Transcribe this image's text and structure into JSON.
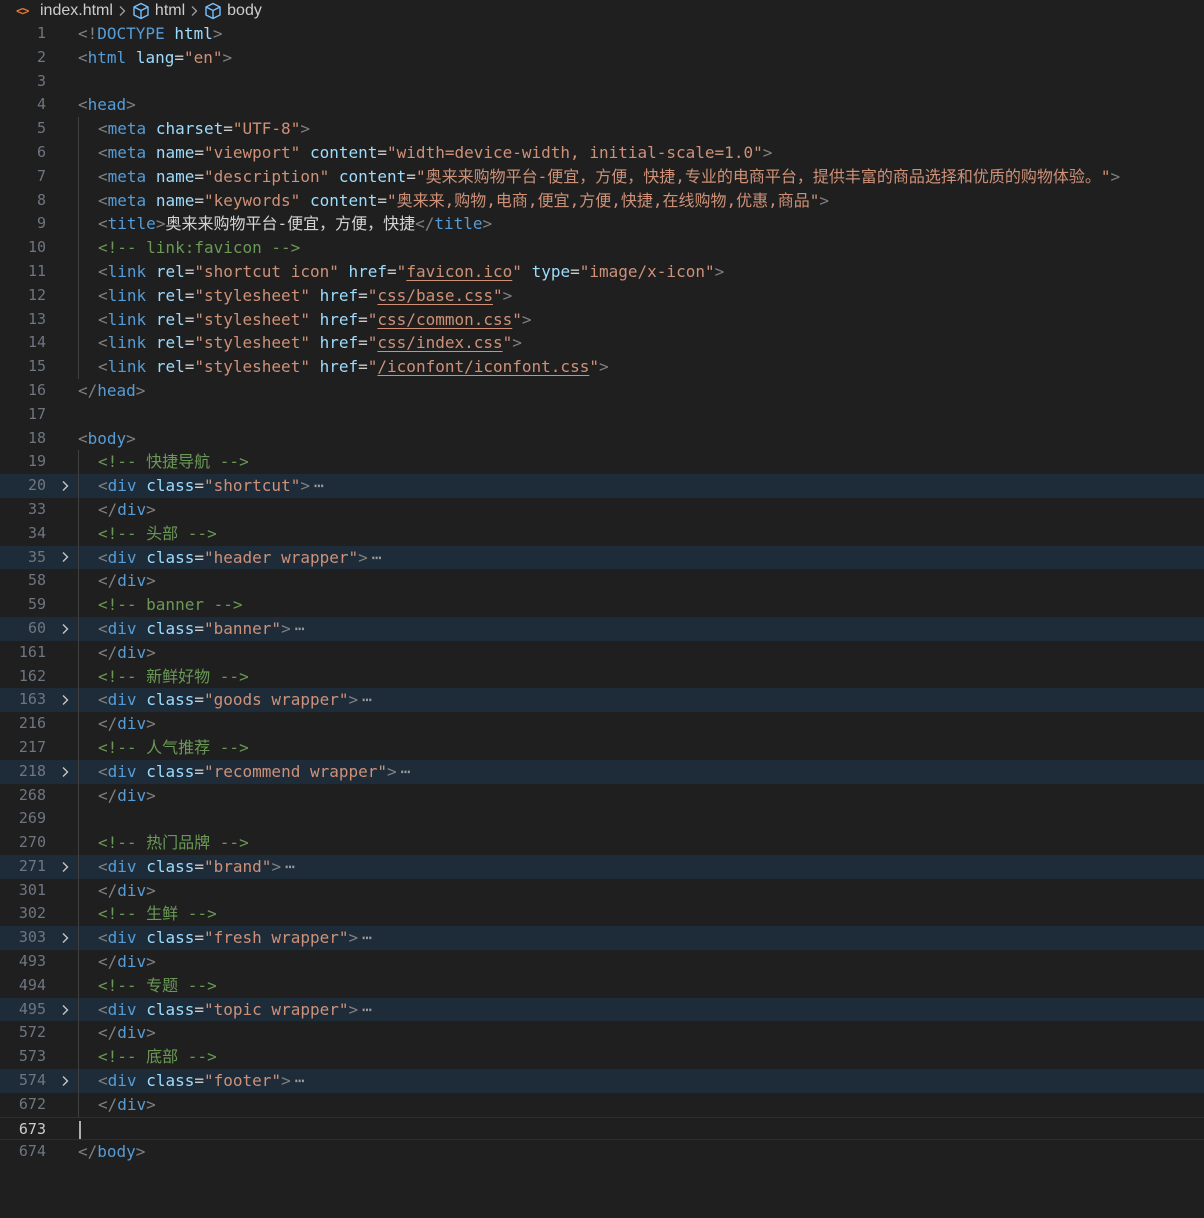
{
  "breadcrumb": {
    "file_icon_glyph": "<>",
    "file": "index.html",
    "items": [
      "html",
      "body"
    ]
  },
  "colors": {
    "background": "#1f1f1f",
    "tag": "#569cd6",
    "attribute": "#9cdcfe",
    "string": "#ce9178",
    "comment": "#6a9955",
    "punctuation": "#808080",
    "folded_highlight": "#1e2c39",
    "line_number": "#6e7681"
  },
  "lines": [
    {
      "n": "1",
      "indent": false,
      "folded": false,
      "html": "<span class='t-punc'>&lt;!</span><span class='t-tag'>DOCTYPE</span> <span class='t-doctype-name'>html</span><span class='t-punc'>&gt;</span>"
    },
    {
      "n": "2",
      "indent": false,
      "folded": false,
      "html": "<span class='t-punc'>&lt;</span><span class='t-tag'>html</span> <span class='t-attr'>lang</span><span class='t-eq'>=</span><span class='t-str'>\"en\"</span><span class='t-punc'>&gt;</span>"
    },
    {
      "n": "3",
      "indent": false,
      "folded": false,
      "html": ""
    },
    {
      "n": "4",
      "indent": false,
      "folded": false,
      "html": "<span class='t-punc'>&lt;</span><span class='t-tag'>head</span><span class='t-punc'>&gt;</span>"
    },
    {
      "n": "5",
      "indent": true,
      "folded": false,
      "html": "<span class='t-punc'>&lt;</span><span class='t-tag'>meta</span> <span class='t-attr'>charset</span><span class='t-eq'>=</span><span class='t-str'>\"UTF-8\"</span><span class='t-punc'>&gt;</span>"
    },
    {
      "n": "6",
      "indent": true,
      "folded": false,
      "html": "<span class='t-punc'>&lt;</span><span class='t-tag'>meta</span> <span class='t-attr'>name</span><span class='t-eq'>=</span><span class='t-str'>\"viewport\"</span> <span class='t-attr'>content</span><span class='t-eq'>=</span><span class='t-str'>\"width=device-width, initial-scale=1.0\"</span><span class='t-punc'>&gt;</span>"
    },
    {
      "n": "7",
      "indent": true,
      "folded": false,
      "html": "<span class='t-punc'>&lt;</span><span class='t-tag'>meta</span> <span class='t-attr'>name</span><span class='t-eq'>=</span><span class='t-str'>\"description\"</span> <span class='t-attr'>content</span><span class='t-eq'>=</span><span class='t-str'>\"奥来来购物平台-便宜，方便，快捷,专业的电商平台，提供丰富的商品选择和优质的购物体验。\"</span><span class='t-punc'>&gt;</span>"
    },
    {
      "n": "8",
      "indent": true,
      "folded": false,
      "html": "<span class='t-punc'>&lt;</span><span class='t-tag'>meta</span> <span class='t-attr'>name</span><span class='t-eq'>=</span><span class='t-str'>\"keywords\"</span> <span class='t-attr'>content</span><span class='t-eq'>=</span><span class='t-str'>\"奥来来,购物,电商,便宜,方便,快捷,在线购物,优惠,商品\"</span><span class='t-punc'>&gt;</span>"
    },
    {
      "n": "9",
      "indent": true,
      "folded": false,
      "html": "<span class='t-punc'>&lt;</span><span class='t-tag'>title</span><span class='t-punc'>&gt;</span><span class='t-text'>奥来来购物平台-便宜，方便，快捷</span><span class='t-punc'>&lt;/</span><span class='t-tag'>title</span><span class='t-punc'>&gt;</span>"
    },
    {
      "n": "10",
      "indent": true,
      "folded": false,
      "html": "<span class='t-comment'>&lt;!-- link:favicon --&gt;</span>"
    },
    {
      "n": "11",
      "indent": true,
      "folded": false,
      "html": "<span class='t-punc'>&lt;</span><span class='t-tag'>link</span> <span class='t-attr'>rel</span><span class='t-eq'>=</span><span class='t-str'>\"shortcut icon\"</span> <span class='t-attr'>href</span><span class='t-eq'>=</span><span class='t-str'>\"</span><span class='t-str-u'>favicon.ico</span><span class='t-str'>\"</span> <span class='t-attr'>type</span><span class='t-eq'>=</span><span class='t-str'>\"image/x-icon\"</span><span class='t-punc'>&gt;</span>"
    },
    {
      "n": "12",
      "indent": true,
      "folded": false,
      "html": "<span class='t-punc'>&lt;</span><span class='t-tag'>link</span> <span class='t-attr'>rel</span><span class='t-eq'>=</span><span class='t-str'>\"stylesheet\"</span> <span class='t-attr'>href</span><span class='t-eq'>=</span><span class='t-str'>\"</span><span class='t-str-u'>css/base.css</span><span class='t-str'>\"</span><span class='t-punc'>&gt;</span>"
    },
    {
      "n": "13",
      "indent": true,
      "folded": false,
      "html": "<span class='t-punc'>&lt;</span><span class='t-tag'>link</span> <span class='t-attr'>rel</span><span class='t-eq'>=</span><span class='t-str'>\"stylesheet\"</span> <span class='t-attr'>href</span><span class='t-eq'>=</span><span class='t-str'>\"</span><span class='t-str-u'>css/common.css</span><span class='t-str'>\"</span><span class='t-punc'>&gt;</span>"
    },
    {
      "n": "14",
      "indent": true,
      "folded": false,
      "html": "<span class='t-punc'>&lt;</span><span class='t-tag'>link</span> <span class='t-attr'>rel</span><span class='t-eq'>=</span><span class='t-str'>\"stylesheet\"</span> <span class='t-attr'>href</span><span class='t-eq'>=</span><span class='t-str'>\"</span><span class='t-str-u'>css/index.css</span><span class='t-str'>\"</span><span class='t-punc'>&gt;</span>"
    },
    {
      "n": "15",
      "indent": true,
      "folded": false,
      "html": "<span class='t-punc'>&lt;</span><span class='t-tag'>link</span> <span class='t-attr'>rel</span><span class='t-eq'>=</span><span class='t-str'>\"stylesheet\"</span> <span class='t-attr'>href</span><span class='t-eq'>=</span><span class='t-str'>\"</span><span class='t-str-u'>/iconfont/iconfont.css</span><span class='t-str'>\"</span><span class='t-punc'>&gt;</span>"
    },
    {
      "n": "16",
      "indent": false,
      "folded": false,
      "html": "<span class='t-punc'>&lt;/</span><span class='t-tag'>head</span><span class='t-punc'>&gt;</span>"
    },
    {
      "n": "17",
      "indent": false,
      "folded": false,
      "html": ""
    },
    {
      "n": "18",
      "indent": false,
      "folded": false,
      "html": "<span class='t-punc'>&lt;</span><span class='t-tag'>body</span><span class='t-punc'>&gt;</span>"
    },
    {
      "n": "19",
      "indent": true,
      "folded": false,
      "html": "<span class='t-comment'>&lt;!-- 快捷导航 --&gt;</span>"
    },
    {
      "n": "20",
      "indent": true,
      "folded": true,
      "html": "<span class='t-punc'>&lt;</span><span class='t-tag'>div</span> <span class='t-attr'>class</span><span class='t-eq'>=</span><span class='t-str'>\"shortcut\"</span><span class='t-punc'>&gt;</span><span class='t-ellipsis'>⋯</span>"
    },
    {
      "n": "33",
      "indent": true,
      "folded": false,
      "html": "<span class='t-punc'>&lt;/</span><span class='t-tag'>div</span><span class='t-punc'>&gt;</span>"
    },
    {
      "n": "34",
      "indent": true,
      "folded": false,
      "html": "<span class='t-comment'>&lt;!-- 头部 --&gt;</span>"
    },
    {
      "n": "35",
      "indent": true,
      "folded": true,
      "html": "<span class='t-punc'>&lt;</span><span class='t-tag'>div</span> <span class='t-attr'>class</span><span class='t-eq'>=</span><span class='t-str'>\"header wrapper\"</span><span class='t-punc'>&gt;</span><span class='t-ellipsis'>⋯</span>"
    },
    {
      "n": "58",
      "indent": true,
      "folded": false,
      "html": "<span class='t-punc'>&lt;/</span><span class='t-tag'>div</span><span class='t-punc'>&gt;</span>"
    },
    {
      "n": "59",
      "indent": true,
      "folded": false,
      "html": "<span class='t-comment'>&lt;!-- banner --&gt;</span>"
    },
    {
      "n": "60",
      "indent": true,
      "folded": true,
      "html": "<span class='t-punc'>&lt;</span><span class='t-tag'>div</span> <span class='t-attr'>class</span><span class='t-eq'>=</span><span class='t-str'>\"banner\"</span><span class='t-punc'>&gt;</span><span class='t-ellipsis'>⋯</span>"
    },
    {
      "n": "161",
      "indent": true,
      "folded": false,
      "html": "<span class='t-punc'>&lt;/</span><span class='t-tag'>div</span><span class='t-punc'>&gt;</span>"
    },
    {
      "n": "162",
      "indent": true,
      "folded": false,
      "html": "<span class='t-comment'>&lt;!-- 新鲜好物 --&gt;</span>"
    },
    {
      "n": "163",
      "indent": true,
      "folded": true,
      "html": "<span class='t-punc'>&lt;</span><span class='t-tag'>div</span> <span class='t-attr'>class</span><span class='t-eq'>=</span><span class='t-str'>\"goods wrapper\"</span><span class='t-punc'>&gt;</span><span class='t-ellipsis'>⋯</span>"
    },
    {
      "n": "216",
      "indent": true,
      "folded": false,
      "html": "<span class='t-punc'>&lt;/</span><span class='t-tag'>div</span><span class='t-punc'>&gt;</span>"
    },
    {
      "n": "217",
      "indent": true,
      "folded": false,
      "html": "<span class='t-comment'>&lt;!-- 人气推荐 --&gt;</span>"
    },
    {
      "n": "218",
      "indent": true,
      "folded": true,
      "html": "<span class='t-punc'>&lt;</span><span class='t-tag'>div</span> <span class='t-attr'>class</span><span class='t-eq'>=</span><span class='t-str'>\"recommend wrapper\"</span><span class='t-punc'>&gt;</span><span class='t-ellipsis'>⋯</span>"
    },
    {
      "n": "268",
      "indent": true,
      "folded": false,
      "html": "<span class='t-punc'>&lt;/</span><span class='t-tag'>div</span><span class='t-punc'>&gt;</span>"
    },
    {
      "n": "269",
      "indent": true,
      "folded": false,
      "html": ""
    },
    {
      "n": "270",
      "indent": true,
      "folded": false,
      "html": "<span class='t-comment'>&lt;!-- 热门品牌 --&gt;</span>"
    },
    {
      "n": "271",
      "indent": true,
      "folded": true,
      "html": "<span class='t-punc'>&lt;</span><span class='t-tag'>div</span> <span class='t-attr'>class</span><span class='t-eq'>=</span><span class='t-str'>\"brand\"</span><span class='t-punc'>&gt;</span><span class='t-ellipsis'>⋯</span>"
    },
    {
      "n": "301",
      "indent": true,
      "folded": false,
      "html": "<span class='t-punc'>&lt;/</span><span class='t-tag'>div</span><span class='t-punc'>&gt;</span>"
    },
    {
      "n": "302",
      "indent": true,
      "folded": false,
      "html": "<span class='t-comment'>&lt;!-- 生鲜 --&gt;</span>"
    },
    {
      "n": "303",
      "indent": true,
      "folded": true,
      "html": "<span class='t-punc'>&lt;</span><span class='t-tag'>div</span> <span class='t-attr'>class</span><span class='t-eq'>=</span><span class='t-str'>\"fresh wrapper\"</span><span class='t-punc'>&gt;</span><span class='t-ellipsis'>⋯</span>"
    },
    {
      "n": "493",
      "indent": true,
      "folded": false,
      "html": "<span class='t-punc'>&lt;/</span><span class='t-tag'>div</span><span class='t-punc'>&gt;</span>"
    },
    {
      "n": "494",
      "indent": true,
      "folded": false,
      "html": "<span class='t-comment'>&lt;!-- 专题 --&gt;</span>"
    },
    {
      "n": "495",
      "indent": true,
      "folded": true,
      "html": "<span class='t-punc'>&lt;</span><span class='t-tag'>div</span> <span class='t-attr'>class</span><span class='t-eq'>=</span><span class='t-str'>\"topic wrapper\"</span><span class='t-punc'>&gt;</span><span class='t-ellipsis'>⋯</span>"
    },
    {
      "n": "572",
      "indent": true,
      "folded": false,
      "html": "<span class='t-punc'>&lt;/</span><span class='t-tag'>div</span><span class='t-punc'>&gt;</span>"
    },
    {
      "n": "573",
      "indent": true,
      "folded": false,
      "html": "<span class='t-comment'>&lt;!-- 底部 --&gt;</span>"
    },
    {
      "n": "574",
      "indent": true,
      "folded": true,
      "html": "<span class='t-punc'>&lt;</span><span class='t-tag'>div</span> <span class='t-attr'>class</span><span class='t-eq'>=</span><span class='t-str'>\"footer\"</span><span class='t-punc'>&gt;</span><span class='t-ellipsis'>⋯</span>"
    },
    {
      "n": "672",
      "indent": true,
      "folded": false,
      "html": "<span class='t-punc'>&lt;/</span><span class='t-tag'>div</span><span class='t-punc'>&gt;</span>"
    },
    {
      "n": "673",
      "indent": false,
      "folded": false,
      "current": true,
      "html": ""
    },
    {
      "n": "674",
      "indent": false,
      "folded": false,
      "html": "<span class='t-punc'>&lt;/</span><span class='t-tag'>body</span><span class='t-punc'>&gt;</span>"
    }
  ]
}
